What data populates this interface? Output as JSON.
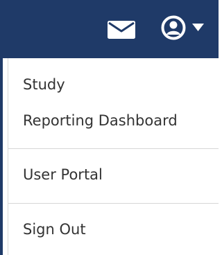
{
  "navbar": {
    "background_color": "#1f3a68",
    "icons": [
      "envelope-icon",
      "user-circle-icon",
      "caret-down-icon"
    ]
  },
  "user_menu": {
    "items": [
      {
        "label": "Study"
      },
      {
        "label": "Reporting Dashboard"
      },
      {
        "label": "User Portal"
      },
      {
        "label": "Sign Out"
      }
    ]
  }
}
